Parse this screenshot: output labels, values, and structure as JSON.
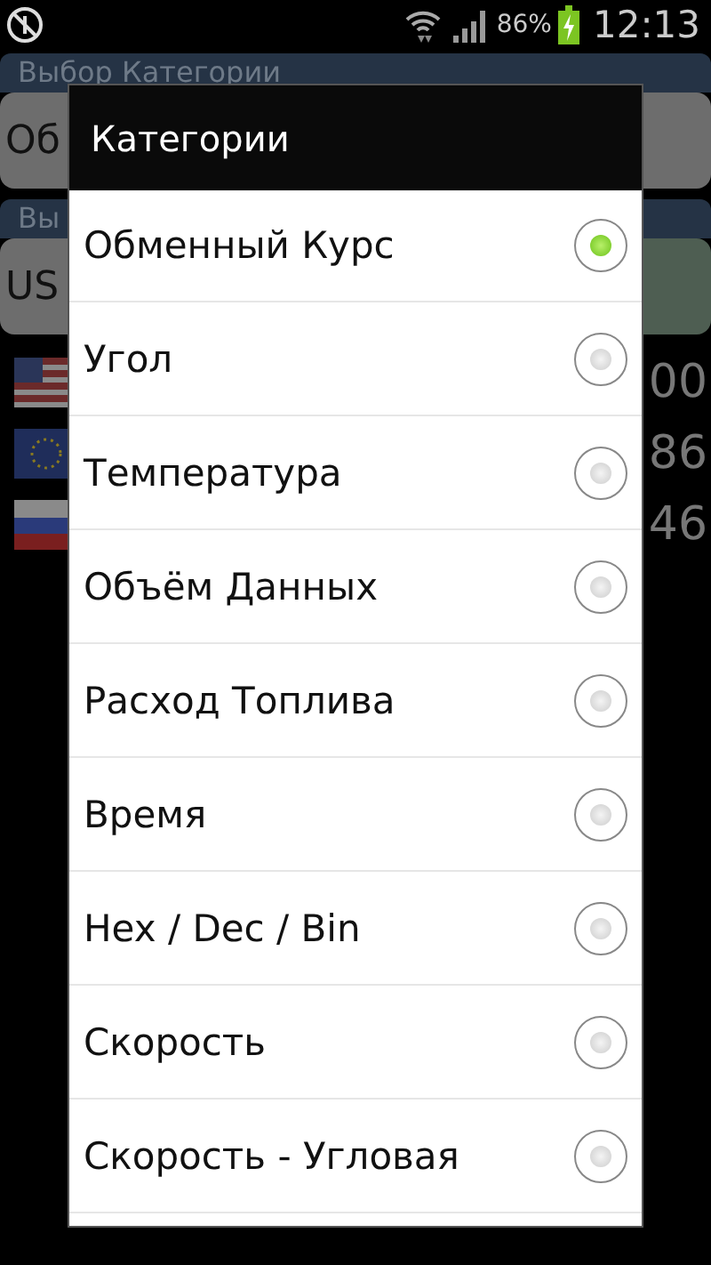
{
  "status_bar": {
    "battery": "86%",
    "time": "12:13"
  },
  "background": {
    "category_header": "Выбор Категории",
    "category_field": "Об",
    "unit_header": "Вы",
    "unit_field": "US",
    "currency_rows": [
      {
        "kind": "us",
        "value": "00"
      },
      {
        "kind": "eu",
        "value": "86"
      },
      {
        "kind": "ru",
        "value": "46"
      }
    ]
  },
  "dialog": {
    "title": "Категории",
    "items": [
      {
        "label": "Обменный Курс",
        "selected": true
      },
      {
        "label": "Угол",
        "selected": false
      },
      {
        "label": "Температура",
        "selected": false
      },
      {
        "label": "Объём Данных",
        "selected": false
      },
      {
        "label": "Расход Топлива",
        "selected": false
      },
      {
        "label": "Время",
        "selected": false
      },
      {
        "label": "Hex / Dec / Bin",
        "selected": false
      },
      {
        "label": "Скорость",
        "selected": false
      },
      {
        "label": "Скорость - Угловая",
        "selected": false
      }
    ]
  }
}
